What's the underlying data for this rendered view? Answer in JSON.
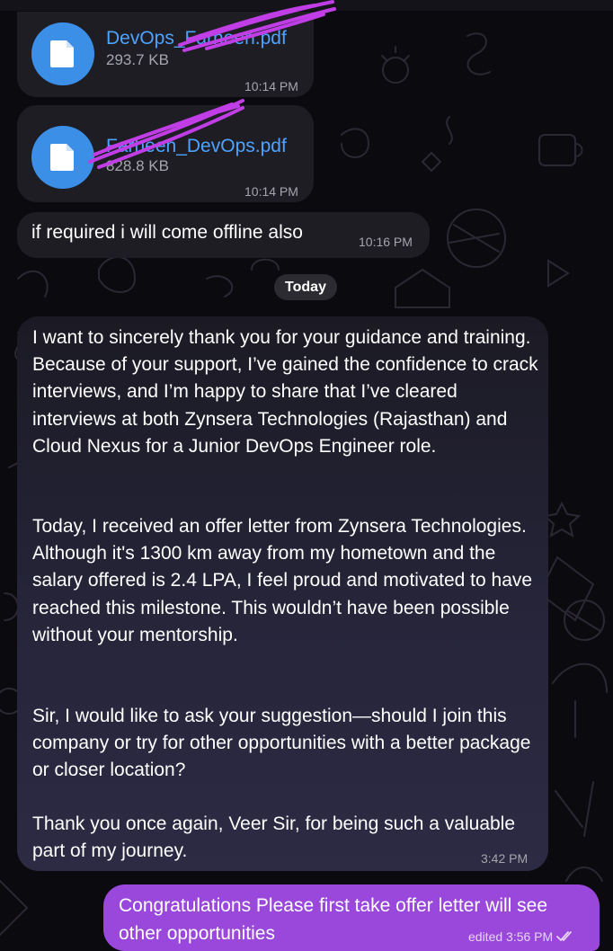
{
  "messages": {
    "file1": {
      "name": "DevOps_Farheen.pdf",
      "size": "293.7 KB",
      "time": "10:14 PM",
      "icon": "file-icon"
    },
    "file2": {
      "name": "Farheen_DevOps.pdf",
      "size": "828.8 KB",
      "time": "10:14 PM",
      "icon": "file-icon"
    },
    "offline": {
      "text": "if required i will come offline also",
      "time": "10:16 PM"
    },
    "date_separator": "Today",
    "long_message": {
      "paragraphs": [
        "I want to sincerely thank you for your guidance and training. Because of your support, I’ve gained the confidence to crack interviews, and I’m happy to share that I’ve cleared interviews at both Zynsera Technologies (Rajasthan) and Cloud Nexus for a Junior DevOps Engineer role.",
        "Today, I received an offer letter from Zynsera Technologies. Although it's 1300 km away from my hometown and the salary offered is 2.4 LPA, I feel proud and motivated to have reached this milestone. This wouldn’t have been possible without your mentorship.",
        "Sir, I would like to ask your suggestion—should I join this company or try for other opportunities with a better package or closer location?",
        "Thank you once again, Veer Sir, for being such a valuable part of my journey."
      ],
      "time": "3:42 PM"
    },
    "reply": {
      "text": "Congratulations Please first take offer letter will see other opportunities",
      "status": "edited 3:56 PM",
      "icon": "double-check-icon"
    }
  },
  "colors": {
    "background": "#0b0a0f",
    "incoming_bubble": "#1e1d24",
    "outgoing_bubble": "#9a47db",
    "link_blue": "#4da3ff",
    "file_icon_bg": "#3b8fe6",
    "redaction_scribble": "#c13ee6"
  }
}
